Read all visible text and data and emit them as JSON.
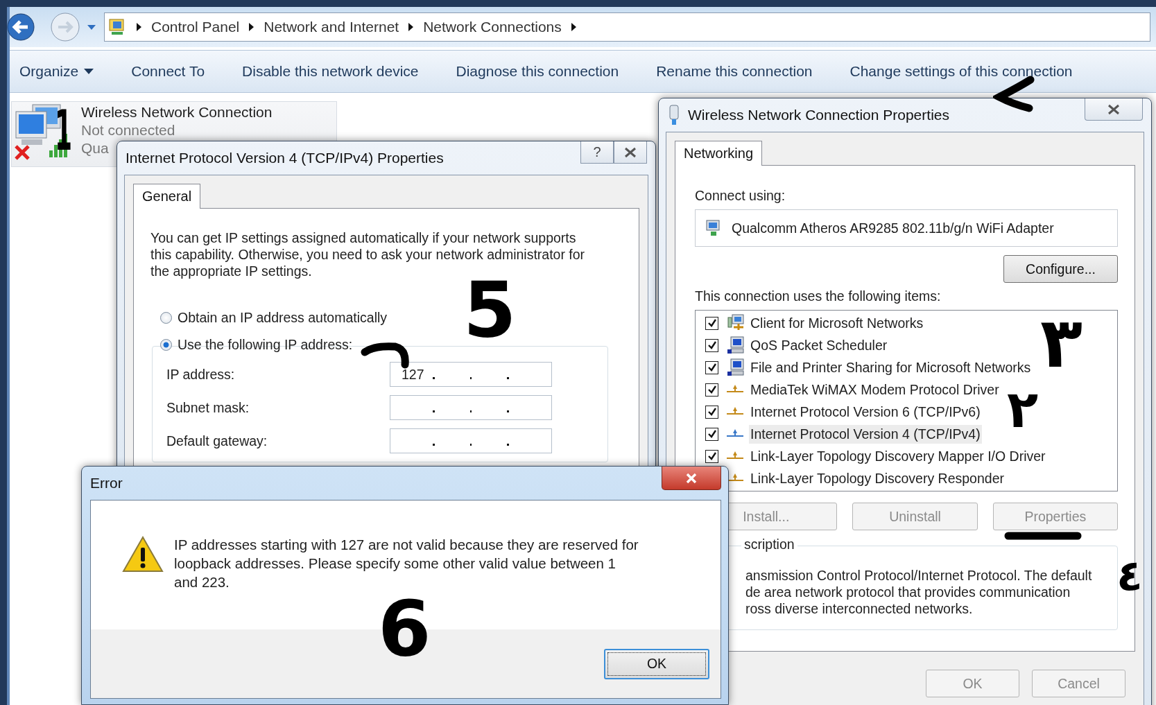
{
  "explorer": {
    "breadcrumbs": [
      "Control Panel",
      "Network and Internet",
      "Network Connections"
    ],
    "toolbar": [
      {
        "label": "Organize",
        "dropdown": true
      },
      {
        "label": "Connect To",
        "dropdown": false
      },
      {
        "label": "Disable this network device",
        "dropdown": false
      },
      {
        "label": "Diagnose this connection",
        "dropdown": false
      },
      {
        "label": "Rename this connection",
        "dropdown": false
      },
      {
        "label": "Change settings of this connection",
        "dropdown": false
      }
    ],
    "connection": {
      "name": "Wireless Network Connection",
      "status": "Not connected",
      "device": "Qua",
      "disconnected": true
    }
  },
  "ipv4_dialog": {
    "title": "Internet Protocol Version 4 (TCP/IPv4) Properties",
    "help_button": "?",
    "tabs": [
      {
        "label": "General",
        "selected": true
      }
    ],
    "intro": "You can get IP settings assigned automatically if your network supports this capability. Otherwise, you need to ask your network administrator for the appropriate IP settings.",
    "options": [
      {
        "label": "Obtain an IP address automatically",
        "selected": false
      },
      {
        "label": "Use the following IP address:",
        "selected": true
      }
    ],
    "fields": [
      {
        "label": "IP address:",
        "value": "127"
      },
      {
        "label": "Subnet mask:"
      },
      {
        "label": "Default gateway:"
      }
    ]
  },
  "properties_dialog": {
    "title": "Wireless Network Connection Properties",
    "tabs": [
      {
        "label": "Networking",
        "selected": true
      }
    ],
    "connect_using_label": "Connect using:",
    "adapter": "Qualcomm Atheros AR9285 802.11b/g/n WiFi Adapter",
    "configure_button": "Configure...",
    "items_label": "This connection uses the following items:",
    "items": [
      {
        "label": "Client for Microsoft Networks",
        "kind": "client",
        "checked": true,
        "selected": false
      },
      {
        "label": "QoS Packet Scheduler",
        "kind": "service",
        "checked": true,
        "selected": false
      },
      {
        "label": "File and Printer Sharing for Microsoft Networks",
        "kind": "service",
        "checked": true,
        "selected": false
      },
      {
        "label": "MediaTek WiMAX Modem Protocol Driver",
        "kind": "protocol",
        "checked": true,
        "selected": false
      },
      {
        "label": "Internet Protocol Version 6 (TCP/IPv6)",
        "kind": "protocol",
        "checked": true,
        "selected": false
      },
      {
        "label": "Internet Protocol Version 4 (TCP/IPv4)",
        "kind": "protocol",
        "checked": true,
        "selected": true
      },
      {
        "label": "Link-Layer Topology Discovery Mapper I/O Driver",
        "kind": "protocol",
        "checked": true,
        "selected": false
      },
      {
        "label": "Link-Layer Topology Discovery Responder",
        "kind": "protocol",
        "selected": false
      }
    ],
    "buttons": [
      {
        "label": "Install...",
        "disabled": true
      },
      {
        "label": "Uninstall",
        "disabled": true
      },
      {
        "label": "Properties",
        "disabled": true
      }
    ],
    "description_label": "scription",
    "description_lines": [
      "ansmission Control Protocol/Internet Protocol. The default",
      "de area network protocol that provides communication",
      "ross diverse interconnected networks."
    ],
    "footer_buttons": [
      {
        "label": "OK",
        "disabled": true
      },
      {
        "label": "Cancel",
        "disabled": true
      }
    ]
  },
  "error_dialog": {
    "title": "Error",
    "message": "IP addresses starting with 127 are not valid because they are reserved for loopback addresses. Please specify some other valid value between 1 and 223.",
    "button": "OK"
  },
  "annotations": [
    {
      "kind": "digit",
      "text": "1"
    },
    {
      "kind": "arrow"
    },
    {
      "kind": "hook"
    },
    {
      "kind": "digit",
      "text": "5"
    },
    {
      "kind": "digit",
      "text": "٣"
    },
    {
      "kind": "digit",
      "text": "٢"
    },
    {
      "kind": "underline"
    },
    {
      "kind": "digit",
      "text": "٤"
    },
    {
      "kind": "digit",
      "text": "6"
    }
  ]
}
